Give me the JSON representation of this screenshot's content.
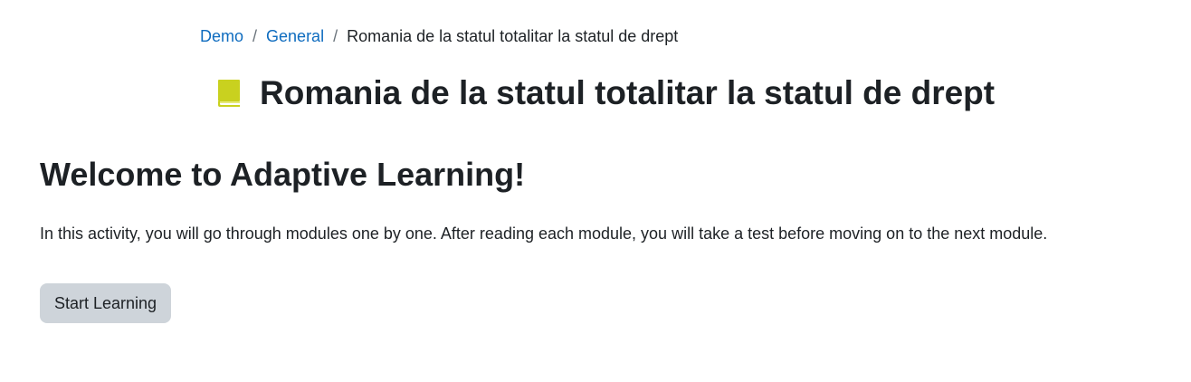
{
  "breadcrumb": {
    "items": [
      {
        "label": "Demo"
      },
      {
        "label": "General"
      }
    ],
    "separator": "/",
    "current": "Romania de la statul totalitar la statul de drept"
  },
  "header": {
    "title": "Romania de la statul totalitar la statul de drept",
    "icon": "book-icon",
    "icon_color": "#c9d11f"
  },
  "main": {
    "heading": "Welcome to Adaptive Learning!",
    "intro": "In this activity, you will go through modules one by one. After reading each module, you will take a test before moving on to the next module.",
    "start_button_label": "Start Learning"
  },
  "colors": {
    "link": "#0f6cbf",
    "text": "#1d2125",
    "button_bg": "#ced4da"
  }
}
